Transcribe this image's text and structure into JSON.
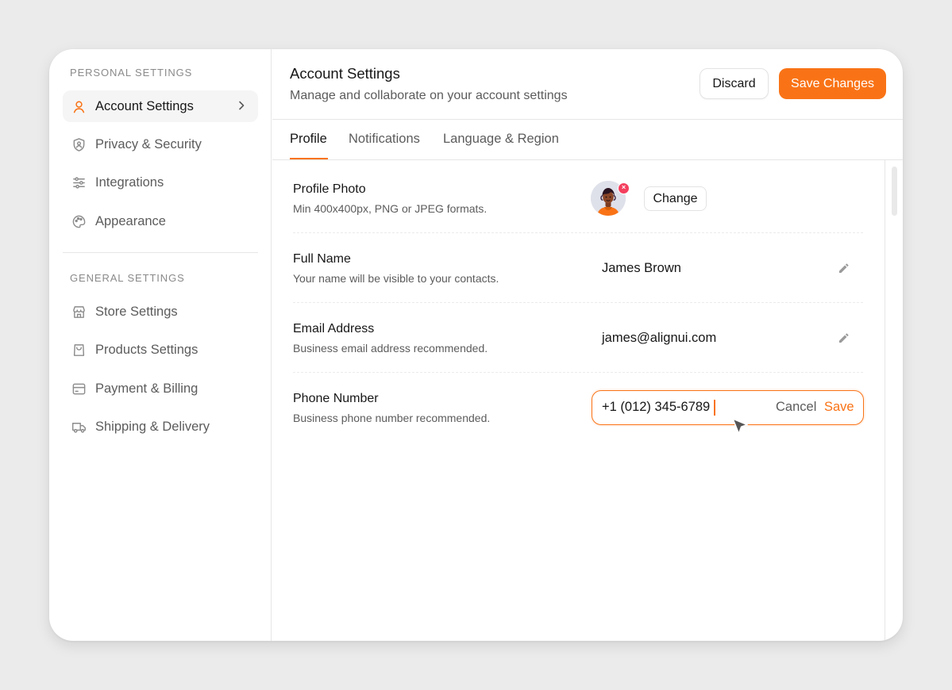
{
  "sidebar": {
    "personal_label": "PERSONAL SETTINGS",
    "personal_items": [
      {
        "label": "Account Settings",
        "icon": "user-icon",
        "active": true
      },
      {
        "label": "Privacy & Security",
        "icon": "shield-user-icon"
      },
      {
        "label": "Integrations",
        "icon": "sliders-icon"
      },
      {
        "label": "Appearance",
        "icon": "palette-icon"
      }
    ],
    "general_label": "GENERAL SETTINGS",
    "general_items": [
      {
        "label": "Store Settings",
        "icon": "store-icon"
      },
      {
        "label": "Products Settings",
        "icon": "shopping-bag-icon"
      },
      {
        "label": "Payment & Billing",
        "icon": "credit-card-icon"
      },
      {
        "label": "Shipping & Delivery",
        "icon": "truck-icon"
      }
    ]
  },
  "header": {
    "title": "Account Settings",
    "subtitle": "Manage and collaborate on your account settings",
    "discard_label": "Discard",
    "save_label": "Save Changes"
  },
  "tabs": [
    {
      "label": "Profile",
      "active": true
    },
    {
      "label": "Notifications"
    },
    {
      "label": "Language & Region"
    }
  ],
  "profile": {
    "photo": {
      "title": "Profile Photo",
      "description": "Min 400x400px, PNG or JPEG formats.",
      "change_label": "Change",
      "remove_symbol": "×"
    },
    "full_name": {
      "title": "Full Name",
      "description": "Your name will be visible to your contacts.",
      "value": "James Brown"
    },
    "email": {
      "title": "Email Address",
      "description": "Business email address recommended.",
      "value": "james@alignui.com"
    },
    "phone": {
      "title": "Phone Number",
      "description": "Business phone number recommended.",
      "value": "+1 (012) 345-6789",
      "cancel_label": "Cancel",
      "save_label": "Save"
    }
  },
  "colors": {
    "accent": "#f97316",
    "danger": "#f43f5e",
    "text_primary": "#171717",
    "text_secondary": "#5c5c5c",
    "border": "#e6e6e6",
    "background": "#ebebeb"
  }
}
